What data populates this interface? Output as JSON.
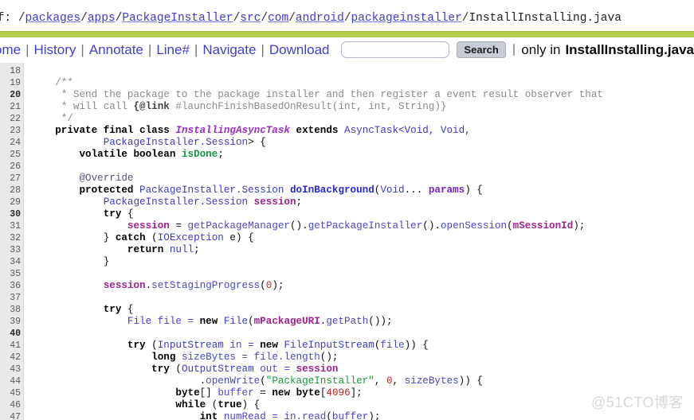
{
  "breadcrumb": {
    "label": "ef:",
    "segments": [
      "packages",
      "apps",
      "PackageInstaller",
      "src",
      "com",
      "android",
      "packageinstaller"
    ],
    "filename": "InstallInstalling.java",
    "separator": "/",
    "link_color": "#3b3bd0"
  },
  "accent": {
    "rule_color": "#b3ce4e",
    "gutter_color": "#e9e9e9"
  },
  "toolbar": {
    "menu_items": [
      "ome",
      "History",
      "Annotate",
      "Line#",
      "Navigate",
      "Download"
    ],
    "separator": "|",
    "search_value": "",
    "search_placeholder": "",
    "search_button_label": "Search",
    "only_in_label": "only in",
    "only_in_file": "InstallInstalling.java",
    "checkbox_checked": false
  },
  "code": {
    "line_numbers": [
      "18",
      "19",
      "20",
      "21",
      "22",
      "23",
      "24",
      "25",
      "26",
      "27",
      "28",
      "29",
      "30",
      "31",
      "32",
      "33",
      "34",
      "35",
      "36",
      "37",
      "38",
      "39",
      "40",
      "41",
      "42",
      "43",
      "44",
      "45",
      "46",
      "47"
    ],
    "bold_line_numbers": [
      "20",
      "30",
      "40"
    ],
    "lines": [
      {
        "n": "18",
        "tokens": []
      },
      {
        "n": "19",
        "tokens": [
          {
            "t": "    ",
            "c": "t-plain"
          },
          {
            "t": "/**",
            "c": "t-cmt"
          }
        ]
      },
      {
        "n": "20",
        "tokens": [
          {
            "t": "     * Send the package to the package installer and then register a event result observer that",
            "c": "t-cmt"
          }
        ]
      },
      {
        "n": "21",
        "tokens": [
          {
            "t": "     * will call ",
            "c": "t-cmt"
          },
          {
            "t": "{@link",
            "c": "t-cmtb"
          },
          {
            "t": " #launchFinishBasedOnResult(int, int, String)}",
            "c": "t-cmt"
          }
        ]
      },
      {
        "n": "22",
        "tokens": [
          {
            "t": "     */",
            "c": "t-cmt"
          }
        ]
      },
      {
        "n": "23",
        "tokens": [
          {
            "t": "    ",
            "c": "t-plain"
          },
          {
            "t": "private final class ",
            "c": "t-kw"
          },
          {
            "t": "InstallingAsyncTask",
            "c": "t-cls"
          },
          {
            "t": " extends ",
            "c": "t-kw"
          },
          {
            "t": "AsyncTask<Void, Void,",
            "c": "t-type"
          }
        ]
      },
      {
        "n": "24",
        "tokens": [
          {
            "t": "            ",
            "c": "t-plain"
          },
          {
            "t": "PackageInstaller.Session",
            "c": "t-type"
          },
          {
            "t": "> {",
            "c": "t-plain"
          }
        ]
      },
      {
        "n": "25",
        "tokens": [
          {
            "t": "        ",
            "c": "t-plain"
          },
          {
            "t": "volatile boolean ",
            "c": "t-kw"
          },
          {
            "t": "isDone",
            "c": "t-green"
          },
          {
            "t": ";",
            "c": "t-plain"
          }
        ]
      },
      {
        "n": "26",
        "tokens": []
      },
      {
        "n": "27",
        "tokens": [
          {
            "t": "        ",
            "c": "t-plain"
          },
          {
            "t": "@Override",
            "c": "t-anno"
          }
        ]
      },
      {
        "n": "28",
        "tokens": [
          {
            "t": "        ",
            "c": "t-plain"
          },
          {
            "t": "protected ",
            "c": "t-kw"
          },
          {
            "t": "PackageInstaller.Session ",
            "c": "t-type"
          },
          {
            "t": "doInBackground",
            "c": "t-method"
          },
          {
            "t": "(",
            "c": "t-plain"
          },
          {
            "t": "Void",
            "c": "t-type"
          },
          {
            "t": "... ",
            "c": "t-plain"
          },
          {
            "t": "params",
            "c": "t-param"
          },
          {
            "t": ") {",
            "c": "t-plain"
          }
        ]
      },
      {
        "n": "29",
        "tokens": [
          {
            "t": "            ",
            "c": "t-plain"
          },
          {
            "t": "PackageInstaller.Session ",
            "c": "t-type"
          },
          {
            "t": "session",
            "c": "t-field"
          },
          {
            "t": ";",
            "c": "t-plain"
          }
        ]
      },
      {
        "n": "30",
        "tokens": [
          {
            "t": "            ",
            "c": "t-plain"
          },
          {
            "t": "try",
            "c": "t-kw"
          },
          {
            "t": " {",
            "c": "t-plain"
          }
        ]
      },
      {
        "n": "31",
        "tokens": [
          {
            "t": "                ",
            "c": "t-plain"
          },
          {
            "t": "session",
            "c": "t-field"
          },
          {
            "t": " = ",
            "c": "t-plain"
          },
          {
            "t": "getPackageManager",
            "c": "t-call"
          },
          {
            "t": "().",
            "c": "t-plain"
          },
          {
            "t": "getPackageInstaller",
            "c": "t-call"
          },
          {
            "t": "().",
            "c": "t-plain"
          },
          {
            "t": "openSession",
            "c": "t-call"
          },
          {
            "t": "(",
            "c": "t-plain"
          },
          {
            "t": "mSessionId",
            "c": "t-field"
          },
          {
            "t": ");",
            "c": "t-plain"
          }
        ]
      },
      {
        "n": "32",
        "tokens": [
          {
            "t": "            } ",
            "c": "t-plain"
          },
          {
            "t": "catch ",
            "c": "t-kw"
          },
          {
            "t": "(",
            "c": "t-plain"
          },
          {
            "t": "IOException",
            "c": "t-type"
          },
          {
            "t": " e) {",
            "c": "t-plain"
          }
        ]
      },
      {
        "n": "33",
        "tokens": [
          {
            "t": "                ",
            "c": "t-plain"
          },
          {
            "t": "return ",
            "c": "t-kw"
          },
          {
            "t": "null",
            "c": "t-type"
          },
          {
            "t": ";",
            "c": "t-plain"
          }
        ]
      },
      {
        "n": "34",
        "tokens": [
          {
            "t": "            }",
            "c": "t-plain"
          }
        ]
      },
      {
        "n": "35",
        "tokens": []
      },
      {
        "n": "36",
        "tokens": [
          {
            "t": "            ",
            "c": "t-plain"
          },
          {
            "t": "session",
            "c": "t-field"
          },
          {
            "t": ".",
            "c": "t-plain"
          },
          {
            "t": "setStagingProgress",
            "c": "t-call"
          },
          {
            "t": "(",
            "c": "t-plain"
          },
          {
            "t": "0",
            "c": "t-num"
          },
          {
            "t": ");",
            "c": "t-plain"
          }
        ]
      },
      {
        "n": "37",
        "tokens": []
      },
      {
        "n": "38",
        "tokens": [
          {
            "t": "            ",
            "c": "t-plain"
          },
          {
            "t": "try",
            "c": "t-kw"
          },
          {
            "t": " {",
            "c": "t-plain"
          }
        ]
      },
      {
        "n": "39",
        "tokens": [
          {
            "t": "                ",
            "c": "t-plain"
          },
          {
            "t": "File",
            "c": "t-type"
          },
          {
            "t": " file = ",
            "c": "t-var"
          },
          {
            "t": "new ",
            "c": "t-kw"
          },
          {
            "t": "File",
            "c": "t-type"
          },
          {
            "t": "(",
            "c": "t-plain"
          },
          {
            "t": "mPackageURI",
            "c": "t-field"
          },
          {
            "t": ".",
            "c": "t-plain"
          },
          {
            "t": "getPath",
            "c": "t-call"
          },
          {
            "t": "());",
            "c": "t-plain"
          }
        ]
      },
      {
        "n": "40",
        "tokens": []
      },
      {
        "n": "41",
        "tokens": [
          {
            "t": "                ",
            "c": "t-plain"
          },
          {
            "t": "try ",
            "c": "t-kw"
          },
          {
            "t": "(",
            "c": "t-plain"
          },
          {
            "t": "InputStream",
            "c": "t-type"
          },
          {
            "t": " in = ",
            "c": "t-var"
          },
          {
            "t": "new ",
            "c": "t-kw"
          },
          {
            "t": "FileInputStream",
            "c": "t-type"
          },
          {
            "t": "(",
            "c": "t-plain"
          },
          {
            "t": "file",
            "c": "t-var"
          },
          {
            "t": ")) {",
            "c": "t-plain"
          }
        ]
      },
      {
        "n": "42",
        "tokens": [
          {
            "t": "                    ",
            "c": "t-plain"
          },
          {
            "t": "long ",
            "c": "t-kw"
          },
          {
            "t": "sizeBytes = file.",
            "c": "t-var"
          },
          {
            "t": "length",
            "c": "t-call"
          },
          {
            "t": "();",
            "c": "t-plain"
          }
        ]
      },
      {
        "n": "43",
        "tokens": [
          {
            "t": "                    ",
            "c": "t-plain"
          },
          {
            "t": "try ",
            "c": "t-kw"
          },
          {
            "t": "(",
            "c": "t-plain"
          },
          {
            "t": "OutputStream",
            "c": "t-type"
          },
          {
            "t": " out = ",
            "c": "t-var"
          },
          {
            "t": "session",
            "c": "t-field"
          }
        ]
      },
      {
        "n": "44",
        "tokens": [
          {
            "t": "                            .",
            "c": "t-plain"
          },
          {
            "t": "openWrite",
            "c": "t-call"
          },
          {
            "t": "(",
            "c": "t-plain"
          },
          {
            "t": "\"PackageInstaller\"",
            "c": "t-str"
          },
          {
            "t": ", ",
            "c": "t-plain"
          },
          {
            "t": "0",
            "c": "t-num"
          },
          {
            "t": ", ",
            "c": "t-plain"
          },
          {
            "t": "sizeBytes",
            "c": "t-var"
          },
          {
            "t": ")) {",
            "c": "t-plain"
          }
        ]
      },
      {
        "n": "45",
        "tokens": [
          {
            "t": "                        ",
            "c": "t-plain"
          },
          {
            "t": "byte",
            "c": "t-kw"
          },
          {
            "t": "[] ",
            "c": "t-plain"
          },
          {
            "t": "buffer",
            "c": "t-var"
          },
          {
            "t": " = ",
            "c": "t-plain"
          },
          {
            "t": "new byte",
            "c": "t-kw"
          },
          {
            "t": "[",
            "c": "t-plain"
          },
          {
            "t": "4096",
            "c": "t-num"
          },
          {
            "t": "];",
            "c": "t-plain"
          }
        ]
      },
      {
        "n": "46",
        "tokens": [
          {
            "t": "                        ",
            "c": "t-plain"
          },
          {
            "t": "while ",
            "c": "t-kw"
          },
          {
            "t": "(",
            "c": "t-plain"
          },
          {
            "t": "true",
            "c": "t-kw"
          },
          {
            "t": ") {",
            "c": "t-plain"
          }
        ]
      },
      {
        "n": "47",
        "tokens": [
          {
            "t": "                            ",
            "c": "t-plain"
          },
          {
            "t": "int ",
            "c": "t-kw"
          },
          {
            "t": "numRead = in.",
            "c": "t-var"
          },
          {
            "t": "read",
            "c": "t-call"
          },
          {
            "t": "(",
            "c": "t-plain"
          },
          {
            "t": "buffer",
            "c": "t-var"
          },
          {
            "t": ");",
            "c": "t-plain"
          }
        ]
      }
    ]
  },
  "watermark": {
    "text": "@51CTO博客"
  }
}
